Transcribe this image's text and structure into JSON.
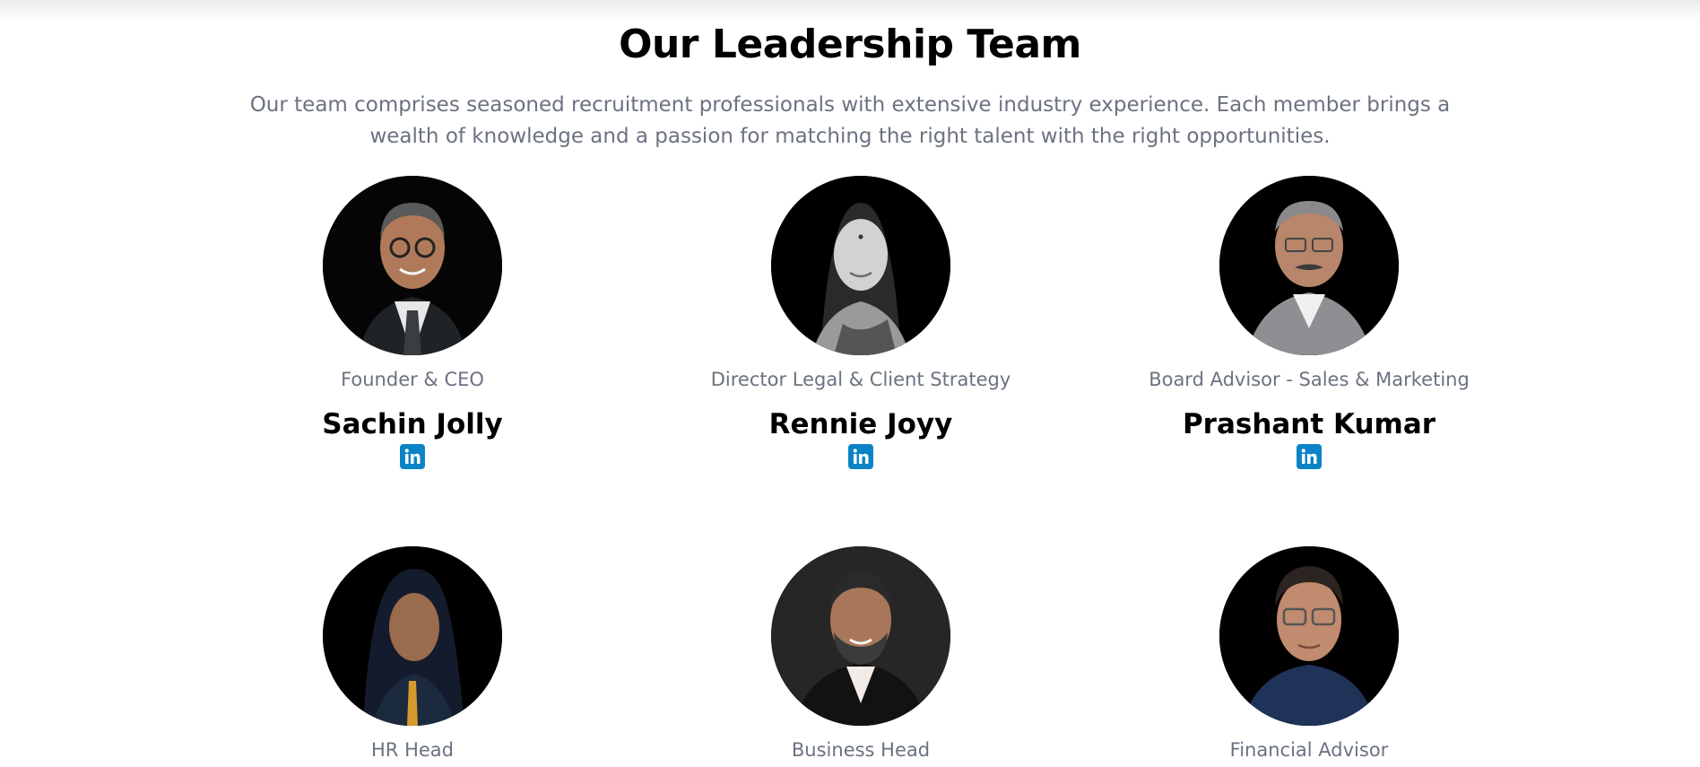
{
  "section": {
    "title": "Our Leadership Team",
    "description": "Our team comprises seasoned recruitment professionals with extensive industry experience. Each member brings a wealth of knowledge and a passion for matching the right talent with the right opportunities."
  },
  "members": [
    {
      "role": "Founder & CEO",
      "name": "Sachin Jolly",
      "linkedin_icon": "linkedin-icon"
    },
    {
      "role": "Director Legal & Client Strategy",
      "name": "Rennie Joyy",
      "linkedin_icon": "linkedin-icon"
    },
    {
      "role": "Board Advisor - Sales & Marketing",
      "name": "Prashant Kumar",
      "linkedin_icon": "linkedin-icon"
    },
    {
      "role": "HR Head"
    },
    {
      "role": "Business Head"
    },
    {
      "role": "Financial Advisor"
    }
  ],
  "colors": {
    "title": "#000000",
    "muted_text": "#6b7280",
    "linkedin": "#0a84c6",
    "photo_background": "#000000"
  }
}
